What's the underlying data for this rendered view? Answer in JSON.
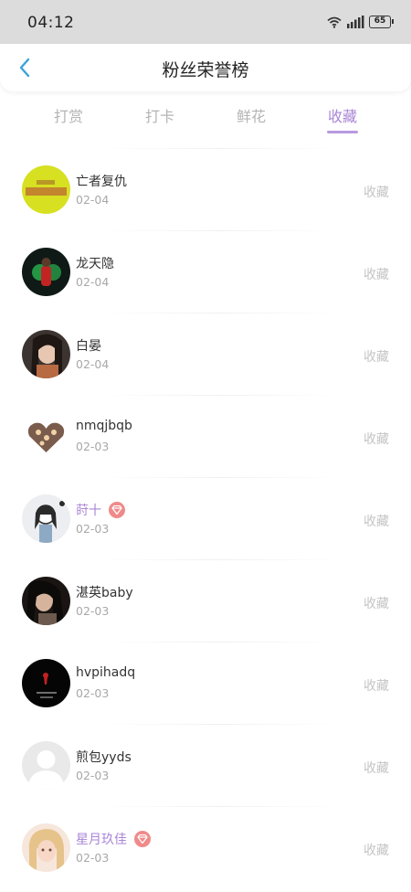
{
  "status": {
    "time": "04:12",
    "battery": "65"
  },
  "header": {
    "title": "粉丝荣誉榜"
  },
  "tabs": [
    {
      "label": "打赏"
    },
    {
      "label": "打卡"
    },
    {
      "label": "鲜花"
    },
    {
      "label": "收藏",
      "active": true
    }
  ],
  "fans": [
    {
      "name": "亡者复仇",
      "date": "02-04",
      "action": "收藏",
      "vip": false
    },
    {
      "name": "龙天隐",
      "date": "02-04",
      "action": "收藏",
      "vip": false
    },
    {
      "name": "白晏",
      "date": "02-04",
      "action": "收藏",
      "vip": false
    },
    {
      "name": "nmqjbqb",
      "date": "02-03",
      "action": "收藏",
      "vip": false
    },
    {
      "name": "莳十",
      "date": "02-03",
      "action": "收藏",
      "vip": true
    },
    {
      "name": "湛英baby",
      "date": "02-03",
      "action": "收藏",
      "vip": false
    },
    {
      "name": "hvpihadq",
      "date": "02-03",
      "action": "收藏",
      "vip": false
    },
    {
      "name": "煎包yyds",
      "date": "02-03",
      "action": "收藏",
      "vip": false
    },
    {
      "name": "星月玖佳",
      "date": "02-03",
      "action": "收藏",
      "vip": true
    }
  ],
  "colors": {
    "accent": "#a985d6",
    "vip_badge": "#f08a8a",
    "back_arrow": "#3aa3d8"
  }
}
